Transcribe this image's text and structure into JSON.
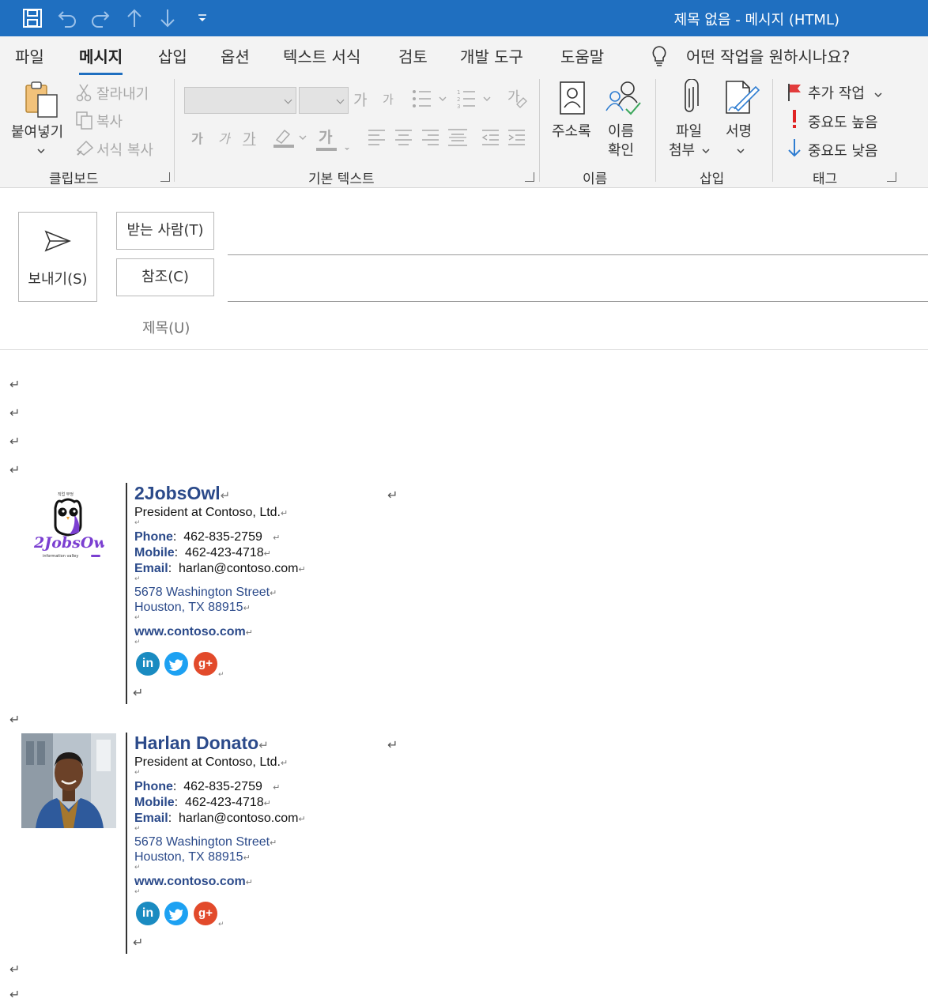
{
  "window": {
    "title": "제목 없음  -  메시지 (HTML)"
  },
  "quick_access": {
    "icons": [
      "save-icon",
      "undo-icon",
      "redo-icon",
      "up-arrow-icon",
      "down-arrow-icon",
      "customize-dropdown-icon"
    ]
  },
  "menu": {
    "tabs": [
      "파일",
      "메시지",
      "삽입",
      "옵션",
      "텍스트 서식",
      "검토",
      "개발 도구",
      "도움말"
    ],
    "active_tab": "메시지",
    "tell_me": "어떤 작업을 원하시나요?"
  },
  "ribbon": {
    "clipboard": {
      "paste": "붙여넣기",
      "cut": "잘라내기",
      "copy": "복사",
      "format_painter": "서식 복사",
      "label": "클립보드"
    },
    "basic_text": {
      "label": "기본 텍스트",
      "grow_font": "가",
      "shrink_font": "가",
      "bold": "가",
      "italic": "가",
      "underline": "가",
      "font_color": "가",
      "clear_format": "가"
    },
    "names": {
      "address_book": "주소록",
      "check_names_1": "이름",
      "check_names_2": "확인",
      "label": "이름"
    },
    "include": {
      "attach_1": "파일",
      "attach_2": "첨부",
      "signature": "서명",
      "label": "삽입"
    },
    "tags": {
      "follow_up": "추가 작업",
      "high_importance": "중요도 높음",
      "low_importance": "중요도 낮음",
      "label": "태그"
    }
  },
  "compose": {
    "send": "보내기(S)",
    "to": "받는 사람(T)",
    "cc": "참조(C)",
    "subject": "제목(U)"
  },
  "paragraph_mark": "↵",
  "signatures": [
    {
      "name": "2JobsOwl",
      "role": "President at Contoso, Ltd.",
      "phone_label": "Phone",
      "phone": "462-835-2759",
      "mobile_label": "Mobile",
      "mobile": "462-423-4718",
      "email_label": "Email",
      "email": "harlan@contoso.com",
      "address1": "5678 Washington Street",
      "address2": "Houston, TX 88915",
      "website": "www.contoso.com",
      "logo_text": "2JobsOwl",
      "logo_tagline": "information valley",
      "logo_top": "직업 부엉"
    },
    {
      "name": "Harlan Donato",
      "role": "President at Contoso, Ltd.",
      "phone_label": "Phone",
      "phone": "462-835-2759",
      "mobile_label": "Mobile",
      "mobile": "462-423-4718",
      "email_label": "Email",
      "email": "harlan@contoso.com",
      "address1": "5678 Washington Street",
      "address2": "Houston, TX 88915",
      "website": "www.contoso.com"
    }
  ],
  "social": {
    "linkedin": "in",
    "twitter": "twitter-bird-icon",
    "googleplus": "g+"
  },
  "colors": {
    "titlebar": "#1f6fc0",
    "linkedin": "#1a8bc1",
    "twitter": "#1da1f2",
    "googleplus": "#e24a2b",
    "signature_blue": "#2b4a8a"
  }
}
